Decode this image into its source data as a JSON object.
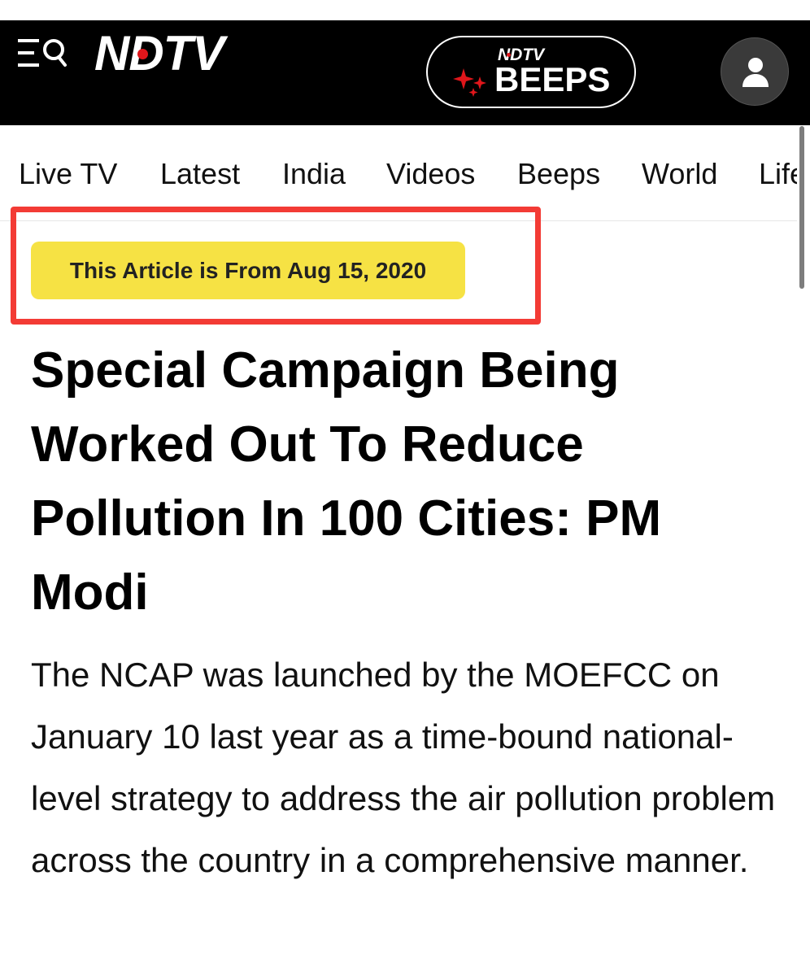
{
  "header": {
    "logo_text": "NDTV",
    "beeps": {
      "small_logo": "NDTV",
      "label": "BEEPS"
    },
    "icons": {
      "menu_search": "menu-search-icon",
      "sparkle": "sparkle-icon",
      "user": "user-icon"
    },
    "colors": {
      "background": "#000000",
      "logo_dot": "#e0161b"
    }
  },
  "nav": {
    "items": [
      {
        "label": "Live TV"
      },
      {
        "label": "Latest"
      },
      {
        "label": "India"
      },
      {
        "label": "Videos"
      },
      {
        "label": "Beeps"
      },
      {
        "label": "World"
      },
      {
        "label": "Life"
      }
    ]
  },
  "article": {
    "date_badge": "This Article is From Aug 15, 2020",
    "headline": "Special Campaign Being Worked Out To Reduce Pollution In 100 Cities: PM Modi",
    "summary": "The NCAP was launched by the MOEFCC on January 10 last year as a time-bound national-level strategy to address the air pollution problem across the country in a comprehensive manner.",
    "colors": {
      "badge_background": "#f6e244",
      "highlight_border": "#f33b35"
    }
  }
}
